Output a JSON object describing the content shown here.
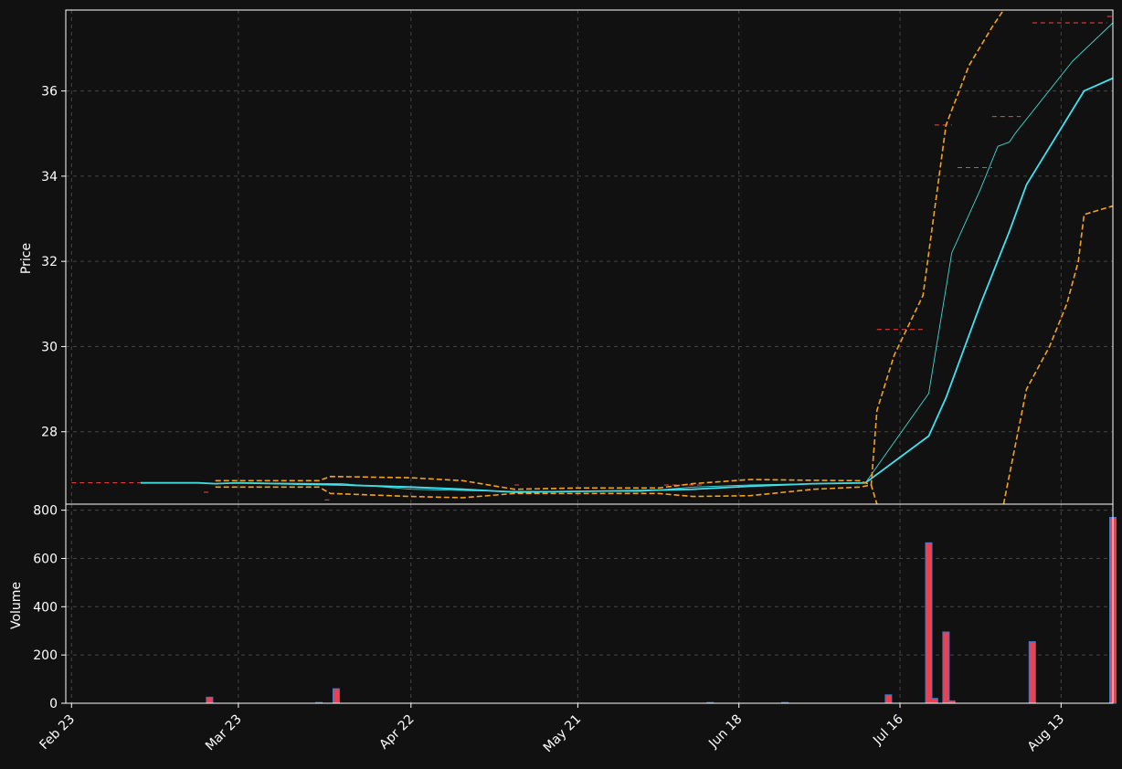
{
  "chart_data": [
    {
      "type": "line",
      "ylabel": "Price",
      "ylim": [
        26.3,
        37.9
      ],
      "y_ticks": [
        28,
        30,
        32,
        34,
        36
      ],
      "grid": true,
      "colors": {
        "background": "#111111",
        "grid": "#444444",
        "price": "#3fe3f3",
        "ma_fast": "#40d8d0",
        "band": "#f5a21b",
        "resistance": "#ff4040"
      },
      "series": [
        {
          "role": "price",
          "points": [
            [
              "2024-03-06",
              26.8
            ],
            [
              "2024-03-16",
              26.8
            ],
            [
              "2024-03-19",
              26.78
            ],
            [
              "2024-03-23",
              26.8
            ],
            [
              "2024-04-10",
              26.75
            ],
            [
              "2024-04-22",
              26.7
            ],
            [
              "2024-05-01",
              26.65
            ],
            [
              "2024-05-10",
              26.58
            ],
            [
              "2024-05-21",
              26.6
            ],
            [
              "2024-06-01",
              26.62
            ],
            [
              "2024-06-10",
              26.65
            ],
            [
              "2024-06-20",
              26.72
            ],
            [
              "2024-07-01",
              26.78
            ],
            [
              "2024-07-10",
              26.8
            ],
            [
              "2024-07-21",
              27.9
            ],
            [
              "2024-07-24",
              28.8
            ],
            [
              "2024-07-30",
              31.0
            ],
            [
              "2024-08-04",
              32.7
            ],
            [
              "2024-08-07",
              33.8
            ],
            [
              "2024-08-17",
              36.0
            ],
            [
              "2024-08-22",
              36.3
            ]
          ]
        },
        {
          "role": "ma_fast",
          "points": [
            [
              "2024-03-06",
              26.8
            ],
            [
              "2024-03-16",
              26.8
            ],
            [
              "2024-03-19",
              26.78
            ],
            [
              "2024-03-23",
              26.8
            ],
            [
              "2024-04-10",
              26.78
            ],
            [
              "2024-04-22",
              26.65
            ],
            [
              "2024-05-01",
              26.62
            ],
            [
              "2024-05-10",
              26.6
            ],
            [
              "2024-05-21",
              26.6
            ],
            [
              "2024-06-01",
              26.6
            ],
            [
              "2024-06-10",
              26.7
            ],
            [
              "2024-06-20",
              26.75
            ],
            [
              "2024-07-01",
              26.78
            ],
            [
              "2024-07-10",
              26.8
            ],
            [
              "2024-07-21",
              28.9
            ],
            [
              "2024-07-25",
              32.2
            ],
            [
              "2024-07-30",
              33.7
            ],
            [
              "2024-08-02",
              34.7
            ],
            [
              "2024-08-04",
              34.8
            ],
            [
              "2024-08-05",
              35.0
            ],
            [
              "2024-08-15",
              36.7
            ],
            [
              "2024-08-22",
              37.6
            ]
          ]
        },
        {
          "role": "band_upper",
          "points": [
            [
              "2024-03-19",
              26.85
            ],
            [
              "2024-04-06",
              26.85
            ],
            [
              "2024-04-08",
              26.95
            ],
            [
              "2024-04-22",
              26.92
            ],
            [
              "2024-05-01",
              26.85
            ],
            [
              "2024-05-10",
              26.65
            ],
            [
              "2024-05-21",
              26.68
            ],
            [
              "2024-06-04",
              26.68
            ],
            [
              "2024-06-10",
              26.78
            ],
            [
              "2024-06-20",
              26.88
            ],
            [
              "2024-07-01",
              26.86
            ],
            [
              "2024-07-09",
              26.85
            ],
            [
              "2024-07-11",
              26.75
            ],
            [
              "2024-07-12",
              28.5
            ],
            [
              "2024-07-15",
              29.8
            ],
            [
              "2024-07-20",
              31.2
            ],
            [
              "2024-07-24",
              35.2
            ],
            [
              "2024-07-28",
              36.6
            ],
            [
              "2024-08-01",
              37.5
            ],
            [
              "2024-08-03",
              37.9
            ]
          ]
        },
        {
          "role": "band_lower",
          "points": [
            [
              "2024-03-19",
              26.7
            ],
            [
              "2024-04-06",
              26.7
            ],
            [
              "2024-04-08",
              26.55
            ],
            [
              "2024-04-22",
              26.48
            ],
            [
              "2024-05-01",
              26.45
            ],
            [
              "2024-05-10",
              26.55
            ],
            [
              "2024-05-21",
              26.55
            ],
            [
              "2024-06-04",
              26.55
            ],
            [
              "2024-06-10",
              26.48
            ],
            [
              "2024-06-20",
              26.5
            ],
            [
              "2024-07-01",
              26.65
            ],
            [
              "2024-07-09",
              26.7
            ],
            [
              "2024-07-11",
              26.75
            ],
            [
              "2024-07-12",
              26.3
            ]
          ]
        },
        {
          "role": "band_lower",
          "points": [
            [
              "2024-08-03",
              26.3
            ],
            [
              "2024-08-07",
              29.0
            ],
            [
              "2024-08-11",
              30.0
            ],
            [
              "2024-08-14",
              31.0
            ],
            [
              "2024-08-16",
              32.0
            ],
            [
              "2024-08-17",
              33.1
            ],
            [
              "2024-08-22",
              33.3
            ]
          ]
        }
      ],
      "levels": [
        {
          "from": "2024-02-23",
          "to": "2024-03-06",
          "value": 26.8
        },
        {
          "from": "2024-03-17",
          "to": "2024-03-18",
          "value": 26.58
        },
        {
          "from": "2024-04-07",
          "to": "2024-04-08",
          "value": 26.4
        },
        {
          "from": "2024-05-10",
          "to": "2024-05-11",
          "value": 26.75
        },
        {
          "from": "2024-06-05",
          "to": "2024-06-12",
          "value": 26.75
        },
        {
          "from": "2024-07-12",
          "to": "2024-07-20",
          "value": 30.4
        },
        {
          "from": "2024-07-22",
          "to": "2024-07-25",
          "value": 35.2
        },
        {
          "from": "2024-07-26",
          "to": "2024-08-01",
          "value": 34.2
        },
        {
          "from": "2024-08-01",
          "to": "2024-08-06",
          "value": 35.4
        },
        {
          "from": "2024-08-08",
          "to": "2024-08-21",
          "value": 37.6
        },
        {
          "from": "2024-08-21",
          "to": "2024-08-22",
          "value": 37.75
        }
      ]
    },
    {
      "type": "bar",
      "ylabel": "Volume",
      "ylim": [
        0,
        825
      ],
      "y_ticks": [
        0,
        200,
        400,
        600,
        800
      ],
      "grid": true,
      "colors": {
        "bar": "#f04050",
        "edge": "#3a7ac8"
      },
      "bars": [
        [
          "2024-03-18",
          25
        ],
        [
          "2024-04-06",
          3
        ],
        [
          "2024-04-09",
          60
        ],
        [
          "2024-06-13",
          3
        ],
        [
          "2024-06-26",
          3
        ],
        [
          "2024-07-14",
          35
        ],
        [
          "2024-07-21",
          665
        ],
        [
          "2024-07-22",
          20
        ],
        [
          "2024-07-24",
          295
        ],
        [
          "2024-07-25",
          10
        ],
        [
          "2024-08-08",
          255
        ],
        [
          "2024-08-22",
          770
        ]
      ]
    }
  ],
  "x_axis": {
    "range": [
      "2024-02-22",
      "2024-08-22"
    ],
    "ticks": [
      {
        "date": "2024-02-23",
        "label": "Feb 23"
      },
      {
        "date": "2024-03-23",
        "label": "Mar 23"
      },
      {
        "date": "2024-04-22",
        "label": "Apr 22"
      },
      {
        "date": "2024-05-21",
        "label": "May 21"
      },
      {
        "date": "2024-06-18",
        "label": "Jun 18"
      },
      {
        "date": "2024-07-16",
        "label": "Jul 16"
      },
      {
        "date": "2024-08-13",
        "label": "Aug 13"
      }
    ]
  }
}
